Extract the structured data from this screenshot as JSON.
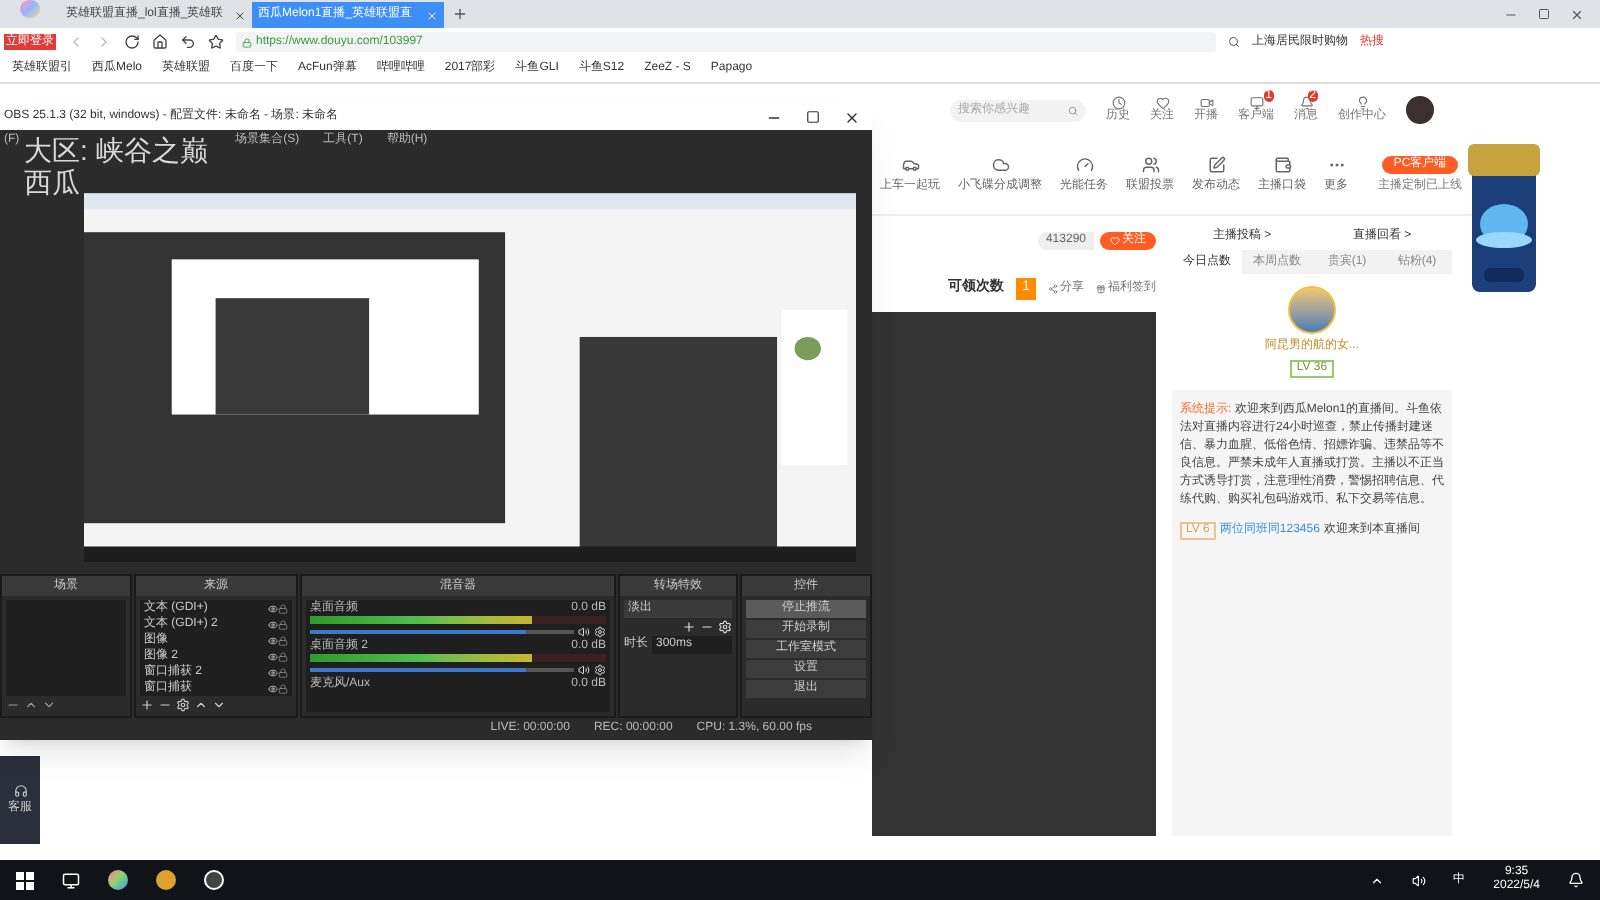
{
  "browser": {
    "badge": "立即登录",
    "tabs": [
      {
        "label": "英雄联盟直播_lol直播_英雄联",
        "selected": false
      },
      {
        "label": "西瓜Melon1直播_英雄联盟直",
        "selected": true
      }
    ],
    "url": "https://www.douyu.com/103997",
    "hot_search": "上海居民限时购物",
    "hot_label": "热搜",
    "bookmarks": [
      "英雄联盟引",
      "西瓜Melo",
      "英雄联盟",
      "百度一下",
      "AcFun弹幕",
      "哔哩哔哩",
      "2017部彩",
      "斗鱼GLI",
      "斗鱼S12",
      "ZeeZ - S",
      "Papago"
    ]
  },
  "site": {
    "search": {
      "placeholder": "搜索你感兴趣"
    },
    "nav": [
      {
        "label": "历史"
      },
      {
        "label": "关注"
      },
      {
        "label": "开播"
      },
      {
        "label": "客户端",
        "count": "1"
      },
      {
        "label": "消息",
        "count": "2"
      },
      {
        "label": "创作中心"
      }
    ],
    "tools": [
      "上车一起玩",
      "小飞碟分成调整",
      "光能任务",
      "联盟投票",
      "发布动态",
      "主播口袋",
      "更多"
    ],
    "pc_client": "PC客户端",
    "pc_note": "主播定制已上线",
    "followers": "413290",
    "follow": "关注",
    "claim": "可领次数",
    "claim_count": "1",
    "share": "分享",
    "sign_in": "福利签到",
    "panel_links": [
      "主播投稿 >",
      "直播回看 >"
    ],
    "rank_tabs": [
      {
        "label": "今日点数",
        "selected": true
      },
      {
        "label": "本周点数",
        "selected": false
      },
      {
        "label": "贵宾(1)",
        "selected": false
      },
      {
        "label": "钻粉(4)",
        "selected": false
      }
    ],
    "top_fan": {
      "name": "阿昆男的航的女...",
      "level": "LV 36"
    },
    "chat": [
      {
        "kind": "system",
        "tag": "系统提示:",
        "text": "欢迎来到西瓜Melon1的直播间。斗鱼依法对直播内容进行24小时巡查，禁止传播封建迷信、暴力血腥、低俗色情、招嫖诈骗、违禁品等不良信息。严禁未成年人直播或打赏。主播以不正当方式诱导打赏，注意理性消费，警惕招聘信息、代练代购、购买礼包码游戏币、私下交易等信息。"
      },
      {
        "kind": "user",
        "level": "LV 6",
        "user": "两位同班同123456",
        "text": "欢迎来到本直播间"
      }
    ],
    "service": "客服"
  },
  "obs": {
    "title": "OBS 25.1.3 (32 bit, windows) - 配置文件: 未命名 - 场景: 未命名",
    "menu_left": "(F)",
    "menu": [
      "场景集合(S)",
      "工具(T)",
      "帮助(H)"
    ],
    "overlay": [
      "大区: 峡谷之巅",
      "西瓜"
    ],
    "docks": {
      "scenes": "场景",
      "sources": "来源",
      "mixer": "混音器",
      "transitions": "转场特效",
      "controls": "控件"
    },
    "sources": [
      "文本 (GDI+)",
      "文本 (GDI+) 2",
      "图像",
      "图像 2",
      "窗口捕获 2",
      "窗口捕获"
    ],
    "channels": [
      {
        "name": "桌面音频",
        "reading": "0.0 dB",
        "level": 0.75,
        "fader": {
          "level": 0.82
        }
      },
      {
        "name": "桌面音频 2",
        "reading": "0.0 dB",
        "level": 0.75,
        "fader": {
          "level": 0.82
        }
      },
      {
        "name": "麦克风/Aux",
        "reading": "0.0 dB"
      }
    ],
    "transition": "淡出",
    "duration_label": "时长",
    "duration": "300ms",
    "buttons": [
      {
        "label": "停止推流",
        "selected": true
      },
      {
        "label": "开始录制",
        "selected": false
      },
      {
        "label": "工作室模式",
        "selected": false
      },
      {
        "label": "设置",
        "selected": false
      },
      {
        "label": "退出",
        "selected": false
      }
    ],
    "status": [
      "LIVE: 00:00:00",
      "REC: 00:00:00",
      "CPU: 1.3%, 60.00 fps"
    ]
  },
  "taskbar": {
    "ime": "中",
    "time": "9:35",
    "date": "2022/5/4"
  }
}
